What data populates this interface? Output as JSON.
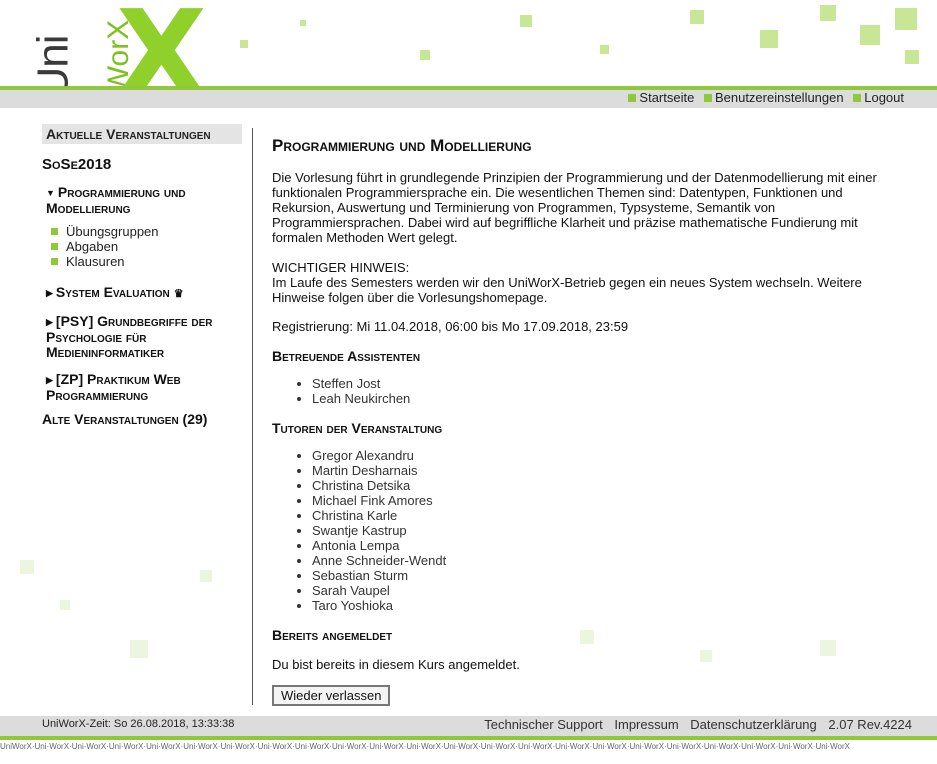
{
  "logo": {
    "uni": "Uni",
    "worx": "WorX",
    "x": "X"
  },
  "nav": {
    "items": [
      "Startseite",
      "Benutzereinstellungen",
      "Logout"
    ]
  },
  "sidebar": {
    "heading": "Aktuelle Veranstaltungen",
    "semester": "SoSe2018",
    "courses": [
      {
        "label": "Programmierung und Modellierung",
        "expanded": true
      },
      {
        "label": "System Evaluation",
        "crown": true
      },
      {
        "label": "[PSY] Grundbegriffe der Psychologie für Medieninformatiker"
      },
      {
        "label": "[ZP] Praktikum Web Programmierung"
      }
    ],
    "subitems": [
      "Übungsgruppen",
      "Abgaben",
      "Klausuren"
    ],
    "old": "Alte Veranstaltungen (29)"
  },
  "main": {
    "title": "Programmierung und Modellierung",
    "description": "Die Vorlesung führt in grundlegende Prinzipien der Programmierung und der Datenmodellierung mit einer funktionalen Programmiersprache ein. Die wesentlichen Themen sind: Datentypen, Funktionen und Rekursion, Auswertung und Terminierung von Programmen, Typsysteme, Semantik von Programmiersprachen. Dabei wird auf begriffliche Klarheit und präzise mathematische Fundierung mit formalen Methoden Wert gelegt.",
    "notice_title": "WICHTIGER HINWEIS:",
    "notice_text": "Im Laufe des Semesters werden wir den UniWorX-Betrieb gegen ein neues System wechseln. Weitere Hinweise folgen über die Vorlesungshomepage.",
    "registration": "Registrierung: Mi 11.04.2018, 06:00 bis Mo 17.09.2018, 23:59",
    "assistants_heading": "Betreuende Assistenten",
    "assistants": [
      "Steffen Jost",
      "Leah Neukirchen"
    ],
    "tutors_heading": "Tutoren der Veranstaltung",
    "tutors": [
      "Gregor Alexandru",
      "Martin Desharnais",
      "Christina Detsika",
      "Michael Fink Amores",
      "Christina Karle",
      "Swantje Kastrup",
      "Antonia Lempa",
      "Anne Schneider-Wendt",
      "Sebastian Sturm",
      "Sarah Vaupel",
      "Taro Yoshioka"
    ],
    "registered_heading": "Bereits angemeldet",
    "registered_text": "Du bist bereits in diesem Kurs angemeldet.",
    "leave_button": "Wieder verlassen"
  },
  "footer": {
    "time": "UniWorX-Zeit: So 26.08.2018, 13:33:38",
    "links": [
      "Technischer Support",
      "Impressum",
      "Datenschutzerklärung"
    ],
    "version": "2.07 Rev.4224",
    "watermark": "UniWorX·Uni·WorX·Uni·WorX·Uni·WorX·Uni·WorX·Uni·WorX·Uni·WorX·Uni·WorX·Uni·WorX·Uni·WorX·Uni·WorX·Uni·WorX·Uni·WorX·Uni·WorX·Uni·WorX·Uni·WorX·Uni·WorX·Uni·WorX·Uni·WorX·Uni·WorX·Uni·WorX·Uni·WorX·Uni·WorX"
  },
  "colors": {
    "accent": "#8fc83a",
    "bar": "#dcdcdc"
  }
}
